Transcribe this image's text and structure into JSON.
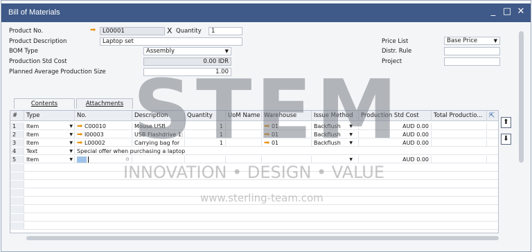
{
  "window": {
    "title": "Bill of Materials"
  },
  "header": {
    "product_no_label": "Product No.",
    "product_no_value": "L00001",
    "x_label": "X",
    "quantity_label": "Quantity",
    "quantity_value": "1",
    "product_desc_label": "Product Description",
    "product_desc_value": "Laptop set",
    "bom_type_label": "BOM Type",
    "bom_type_value": "Assembly",
    "prod_std_cost_label": "Production Std Cost",
    "prod_std_cost_value": "0.00 IDR",
    "planned_avg_label": "Planned Average Production Size",
    "planned_avg_value": "1.00",
    "price_list_label": "Price List",
    "price_list_value": "Base Price",
    "distr_rule_label": "Distr. Rule",
    "distr_rule_value": "",
    "project_label": "Project",
    "project_value": ""
  },
  "tabs": [
    {
      "label": "Contents"
    },
    {
      "label": "Attachments"
    }
  ],
  "grid": {
    "columns": [
      "#",
      "Type",
      "No.",
      "Description",
      "Quantity",
      "UoM Name",
      "Warehouse",
      "Issue Method",
      "Production Std Cost",
      "Total Productio..."
    ],
    "rows": [
      {
        "num": "1",
        "type": "Item",
        "no": "C00010",
        "desc": "Mouse USB",
        "qty": "1",
        "uom": "",
        "wh": "01",
        "issue": "Backflush",
        "cost": "AUD 0.00",
        "total": ""
      },
      {
        "num": "2",
        "type": "Item",
        "no": "I00003",
        "desc": "USB Flashdrive 1:",
        "qty": "1",
        "uom": "",
        "wh": "01",
        "issue": "Backflush",
        "cost": "AUD 0.00",
        "total": ""
      },
      {
        "num": "3",
        "type": "Item",
        "no": "L00002",
        "desc": "Carrying bag for",
        "qty": "1",
        "uom": "",
        "wh": "01",
        "issue": "Backflush",
        "cost": "AUD 0.00",
        "total": ""
      },
      {
        "num": "4",
        "type": "Text",
        "text": "Special offer when purchasing a laptop"
      },
      {
        "num": "5",
        "type": "Item",
        "no": "",
        "desc": "",
        "qty": "",
        "uom": "",
        "wh": "",
        "issue": "",
        "cost": "AUD 0.00",
        "total": ""
      }
    ]
  },
  "watermark": {
    "big": "STEM",
    "tagline": "INNOVATION • DESIGN • VALUE",
    "url": "www.sterling-team.com"
  },
  "icons": {
    "arrow": "link-arrow-icon",
    "minimize": "minimize-icon",
    "maximize": "maximize-icon",
    "close": "close-icon"
  },
  "colors": {
    "titlebar": "#3f5a88",
    "link_arrow": "#e8930f"
  }
}
